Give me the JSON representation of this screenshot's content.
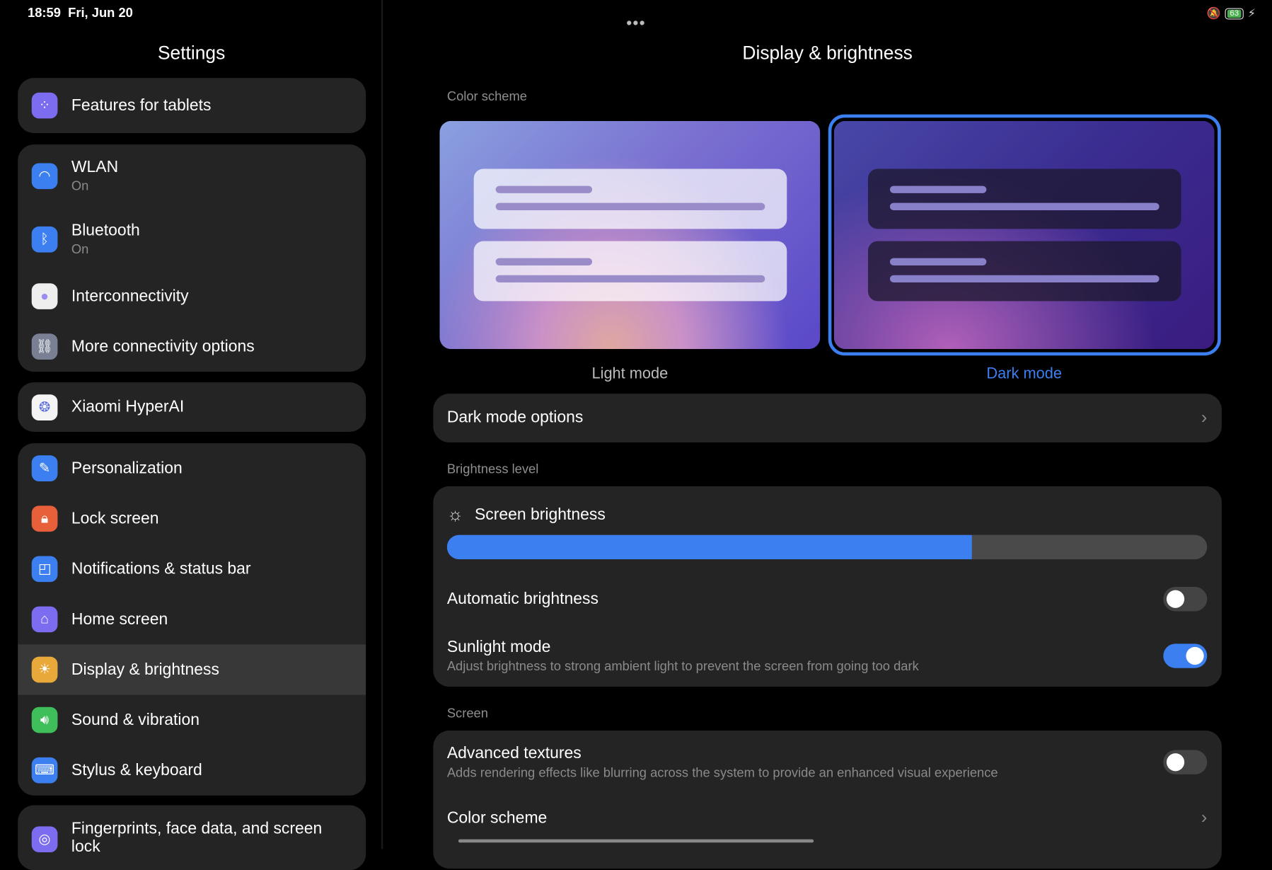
{
  "status_bar": {
    "time": "18:59",
    "date": "Fri, Jun 20",
    "battery": "63"
  },
  "sidebar": {
    "title": "Settings",
    "items": [
      {
        "label": "Features for tablets",
        "icon": "grid-icon",
        "color": "#7b6cf0"
      },
      {
        "label": "WLAN",
        "sub": "On",
        "icon": "wifi-icon",
        "color": "#3b7ff0"
      },
      {
        "label": "Bluetooth",
        "sub": "On",
        "icon": "bluetooth-icon",
        "color": "#3b7ff0"
      },
      {
        "label": "Interconnectivity",
        "icon": "interconnectivity-icon",
        "color": "#eeeeee"
      },
      {
        "label": "More connectivity options",
        "icon": "link-icon",
        "color": "#7a8094"
      },
      {
        "label": "Xiaomi HyperAI",
        "icon": "hyperai-icon",
        "color": "#f4f4f4"
      },
      {
        "label": "Personalization",
        "icon": "brush-icon",
        "color": "#3b7ff0"
      },
      {
        "label": "Lock screen",
        "icon": "lock-icon",
        "color": "#e8603a"
      },
      {
        "label": "Notifications & status bar",
        "icon": "notification-icon",
        "color": "#3b7ff0"
      },
      {
        "label": "Home screen",
        "icon": "home-icon",
        "color": "#7b6cf0"
      },
      {
        "label": "Display & brightness",
        "icon": "sun-icon",
        "color": "#e8a83a"
      },
      {
        "label": "Sound & vibration",
        "icon": "speaker-icon",
        "color": "#3fbf5a"
      },
      {
        "label": "Stylus & keyboard",
        "icon": "keyboard-icon",
        "color": "#3b7ff0"
      },
      {
        "label": "Fingerprints, face data, and screen lock",
        "icon": "fingerprint-icon",
        "color": "#7b6cf0"
      }
    ]
  },
  "main": {
    "title": "Display & brightness",
    "color_scheme_label": "Color scheme",
    "light_mode": "Light mode",
    "dark_mode": "Dark mode",
    "selected_mode": "Dark mode",
    "dark_mode_options": "Dark mode options",
    "brightness_label": "Brightness level",
    "screen_brightness": "Screen brightness",
    "brightness_percent": 69,
    "automatic_brightness": {
      "label": "Automatic brightness",
      "on": false
    },
    "sunlight_mode": {
      "label": "Sunlight mode",
      "sub": "Adjust brightness to strong ambient light to prevent the screen from going too dark",
      "on": true
    },
    "screen_label": "Screen",
    "advanced_textures": {
      "label": "Advanced textures",
      "sub": "Adds rendering effects like blurring across the system to provide an enhanced visual experience",
      "on": false
    },
    "color_scheme_row": "Color scheme"
  },
  "colors": {
    "accent": "#3b7ff0",
    "background": "#000000",
    "card": "#242424"
  }
}
